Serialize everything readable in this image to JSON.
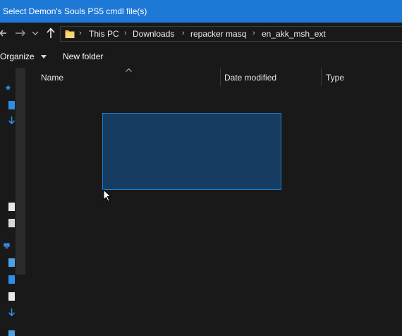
{
  "window": {
    "title": "Select Demon's Souls PS5 cmdl file(s)"
  },
  "address_bar": {
    "crumbs": [
      "This PC",
      "Downloads",
      "repacker masq",
      "en_akk_msh_ext"
    ]
  },
  "toolbar": {
    "organize_label": "Organize",
    "new_folder_label": "New folder"
  },
  "columns": {
    "name": "Name",
    "date_modified": "Date modified",
    "type": "Type"
  },
  "colors": {
    "titlebar": "#1e78d6",
    "background": "#191919",
    "selection_fill": "#173c61",
    "selection_border": "#1c7ed6"
  }
}
